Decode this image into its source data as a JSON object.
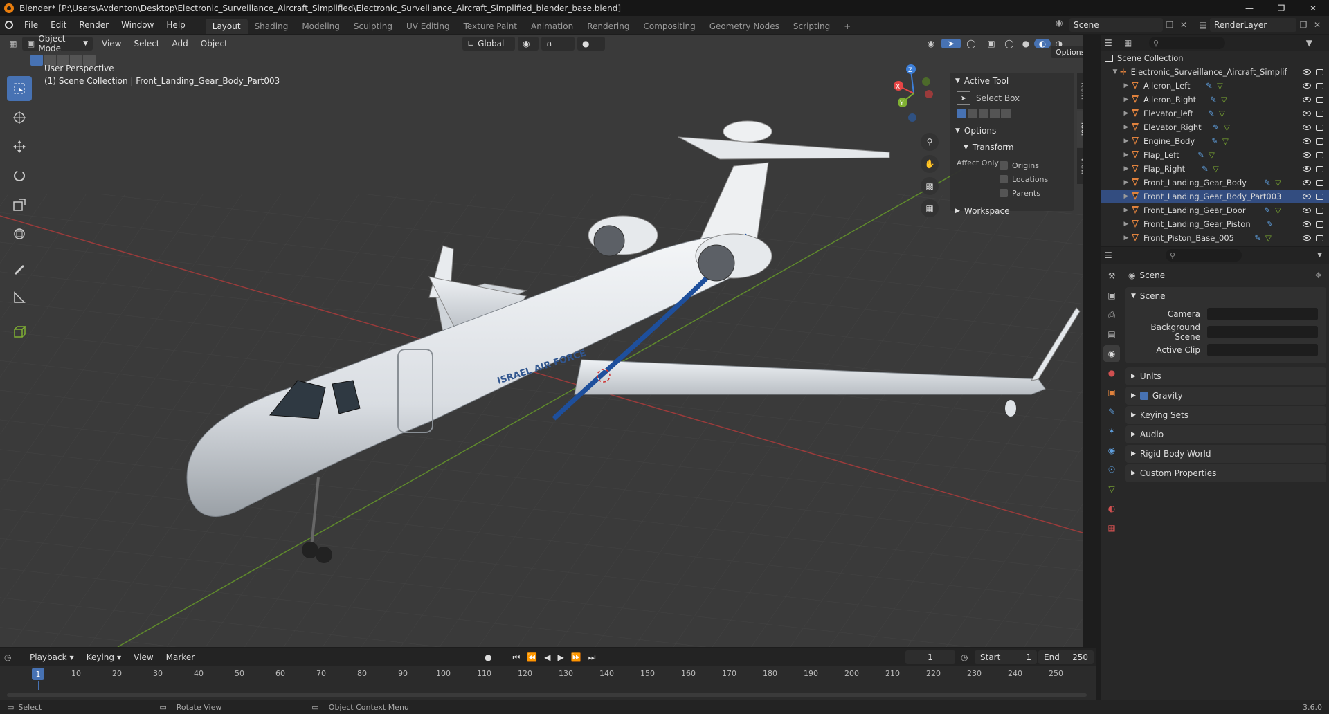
{
  "titlebar": {
    "title": "Blender* [P:\\Users\\Avdenton\\Desktop\\Electronic_Surveillance_Aircraft_Simplified\\Electronic_Surveillance_Aircraft_Simplified_blender_base.blend]"
  },
  "menu": {
    "items": [
      "File",
      "Edit",
      "Render",
      "Window",
      "Help"
    ]
  },
  "workspaces": [
    {
      "label": "Layout",
      "active": true
    },
    {
      "label": "Shading"
    },
    {
      "label": "Modeling"
    },
    {
      "label": "Sculpting"
    },
    {
      "label": "UV Editing"
    },
    {
      "label": "Texture Paint"
    },
    {
      "label": "Animation"
    },
    {
      "label": "Rendering"
    },
    {
      "label": "Compositing"
    },
    {
      "label": "Geometry Nodes"
    },
    {
      "label": "Scripting"
    }
  ],
  "scene_selector": {
    "scene": "Scene",
    "view_layer": "RenderLayer"
  },
  "viewport": {
    "mode": "Object Mode",
    "menus": [
      "View",
      "Select",
      "Add",
      "Object"
    ],
    "orientation": "Global",
    "options_label": "Options",
    "info_line1": "User Perspective",
    "info_line2": "(1) Scene Collection | Front_Landing_Gear_Body_Part003",
    "aircraft_text": "ISRAEL AIR FORCE",
    "npanel": {
      "tabs": [
        "Item",
        "Tool",
        "View"
      ],
      "active_tool_header": "Active Tool",
      "tool_name": "Select Box",
      "options_header": "Options",
      "transform_header": "Transform",
      "affect_only_label": "Affect Only",
      "affect": [
        "Origins",
        "Locations",
        "Parents"
      ],
      "workspace_header": "Workspace"
    },
    "gizmo": {
      "x": "X",
      "y": "Y",
      "z": "Z"
    }
  },
  "outliner": {
    "root": "Scene Collection",
    "collection": "Electronic_Surveillance_Aircraft_Simplif",
    "items": [
      {
        "name": "Aileron_Left"
      },
      {
        "name": "Aileron_Right"
      },
      {
        "name": "Elevator_left"
      },
      {
        "name": "Elevator_Right"
      },
      {
        "name": "Engine_Body"
      },
      {
        "name": "Flap_Left"
      },
      {
        "name": "Flap_Right"
      },
      {
        "name": "Front_Landing_Gear_Body"
      },
      {
        "name": "Front_Landing_Gear_Body_Part003",
        "selected": true
      },
      {
        "name": "Front_Landing_Gear_Door"
      },
      {
        "name": "Front_Landing_Gear_Piston"
      },
      {
        "name": "Front_Piston_Base_005"
      }
    ]
  },
  "properties": {
    "context": "Scene",
    "panel_title": "Scene",
    "camera_label": "Camera",
    "background_label": "Background Scene",
    "clip_label": "Active Clip",
    "sections": [
      "Units",
      "Gravity",
      "Keying Sets",
      "Audio",
      "Rigid Body World",
      "Custom Properties"
    ]
  },
  "timeline": {
    "menus": [
      "Playback",
      "Keying",
      "View",
      "Marker"
    ],
    "current_frame": "1",
    "start_label": "Start",
    "start": "1",
    "end_label": "End",
    "end": "250",
    "ruler": [
      "1",
      "10",
      "20",
      "30",
      "40",
      "50",
      "60",
      "70",
      "80",
      "90",
      "100",
      "110",
      "120",
      "130",
      "140",
      "150",
      "160",
      "170",
      "180",
      "190",
      "200",
      "210",
      "220",
      "230",
      "240",
      "250"
    ]
  },
  "statusbar": {
    "select": "Select",
    "rotate": "Rotate View",
    "context_menu": "Object Context Menu",
    "version": "3.6.0"
  },
  "colors": {
    "accent": "#4772b3",
    "selected_row": "#334d80",
    "x_axis": "#e64545",
    "y_axis": "#7fb032",
    "z_axis": "#3d7fd8",
    "mesh_icon": "#e0823d"
  }
}
